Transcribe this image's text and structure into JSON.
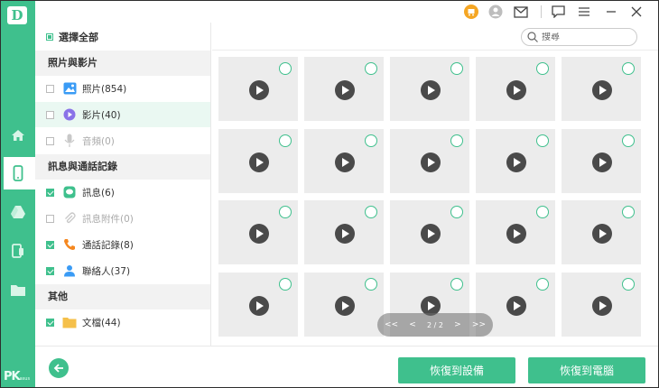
{
  "app": {
    "logo_letter": "D",
    "watermark": "PK",
    "watermark_small": "asus"
  },
  "search": {
    "placeholder": "搜尋"
  },
  "select_all": {
    "label": "選擇全部"
  },
  "sections": {
    "media": "照片與影片",
    "messages": "訊息與通話記錄",
    "other": "其他"
  },
  "categories": [
    {
      "label": "照片(854)",
      "checked": false,
      "disabled": false,
      "icon": "photo-icon"
    },
    {
      "label": "影片(40)",
      "checked": false,
      "disabled": false,
      "icon": "video-icon"
    },
    {
      "label": "音頻(0)",
      "checked": false,
      "disabled": true,
      "icon": "microphone-icon"
    },
    {
      "label": "訊息(6)",
      "checked": true,
      "disabled": false,
      "icon": "message-icon"
    },
    {
      "label": "訊息附件(0)",
      "checked": false,
      "disabled": true,
      "icon": "paperclip-icon"
    },
    {
      "label": "通話記錄(8)",
      "checked": true,
      "disabled": false,
      "icon": "phone-icon"
    },
    {
      "label": "聯絡人(37)",
      "checked": true,
      "disabled": false,
      "icon": "contact-icon"
    },
    {
      "label": "文檔(44)",
      "checked": true,
      "disabled": false,
      "icon": "folder-icon"
    }
  ],
  "pager": {
    "first": "<<",
    "prev": "<",
    "page": "2 / 2",
    "next": ">",
    "last": ">>"
  },
  "buttons": {
    "recover_device": "恢復到設備",
    "recover_pc": "恢復到電腦"
  },
  "colors": {
    "accent": "#3fc08d",
    "tile": "#ececec",
    "play": "#4a4a4a",
    "cart": "#f5a623"
  },
  "grid": {
    "rows": 4,
    "cols": 5
  }
}
